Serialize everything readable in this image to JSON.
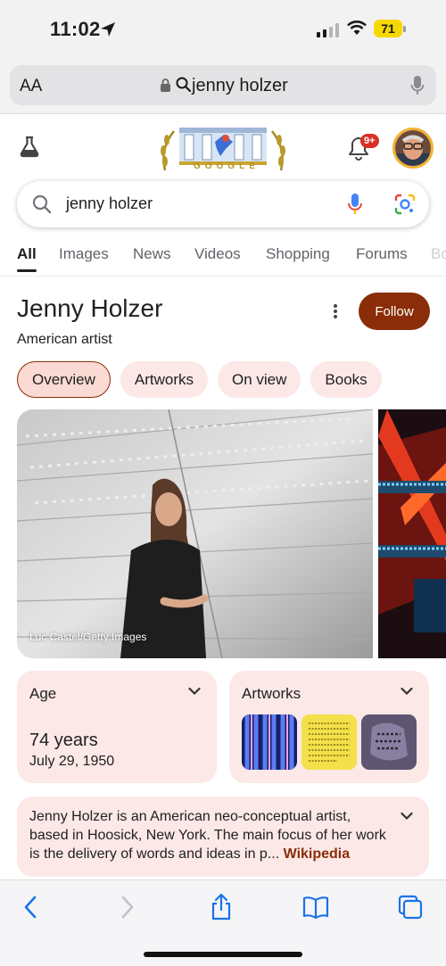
{
  "status_bar": {
    "time": "11:02",
    "battery": "71",
    "battery_color": "#f5d800"
  },
  "address_bar": {
    "aa_label": "AA",
    "url_text": "jenny holzer"
  },
  "header": {
    "doodle_text": "GOOGLE",
    "notification_badge": "9+"
  },
  "search": {
    "query": "jenny holzer"
  },
  "tabs": [
    {
      "label": "All",
      "active": true
    },
    {
      "label": "Images"
    },
    {
      "label": "News"
    },
    {
      "label": "Videos"
    },
    {
      "label": "Shopping"
    },
    {
      "label": "Forums"
    },
    {
      "label": "Bo"
    }
  ],
  "knowledge_panel": {
    "title": "Jenny Holzer",
    "subtitle": "American artist",
    "follow_label": "Follow",
    "accent_color": "#8a2d08",
    "chips": [
      {
        "label": "Overview",
        "selected": true
      },
      {
        "label": "Artworks"
      },
      {
        "label": "On view"
      },
      {
        "label": "Books"
      }
    ],
    "image_caption": "Luc Castel/Getty Images",
    "age_card": {
      "label": "Age",
      "value": "74 years",
      "date": "July 29, 1950"
    },
    "artworks_card": {
      "label": "Artworks"
    },
    "description": {
      "text": "Jenny Holzer is an American neo-conceptual artist, based in Hoosick, New York. The main focus of her work is the delivery of words and ideas in p...",
      "link": "Wikipedia"
    }
  }
}
